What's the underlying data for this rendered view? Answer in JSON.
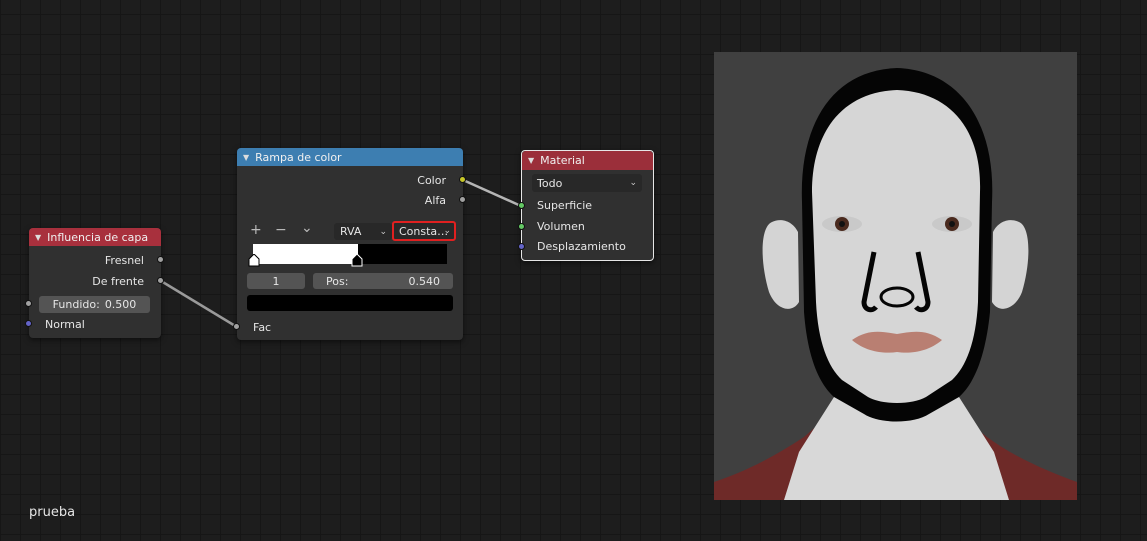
{
  "layer_weight_node": {
    "title": "Influencia de capa",
    "outputs": [
      "Fresnel",
      "De frente"
    ],
    "blend_label": "Fundido:",
    "blend_value": "0.500",
    "normal_label": "Normal"
  },
  "color_ramp_node": {
    "title": "Rampa de color",
    "output_color": "Color",
    "output_alpha": "Alfa",
    "add_symbol": "+",
    "remove_symbol": "−",
    "menu_symbol": "⌄",
    "color_mode": "RVA",
    "interpolation": "Consta…",
    "stop_index": "1",
    "pos_label": "Pos:",
    "pos_value": "0.540",
    "stop_position": 0.54,
    "input_fac": "Fac"
  },
  "material_output_node": {
    "title": "Material",
    "target": "Todo",
    "inputs": [
      "Superficie",
      "Volumen",
      "Desplazamiento"
    ]
  },
  "material_name": "prueba",
  "colors": {
    "layer_header": "#a8303d",
    "ramp_header": "#3d7eb1",
    "material_header": "#9b2f3a",
    "highlight_box": "#e02020"
  }
}
